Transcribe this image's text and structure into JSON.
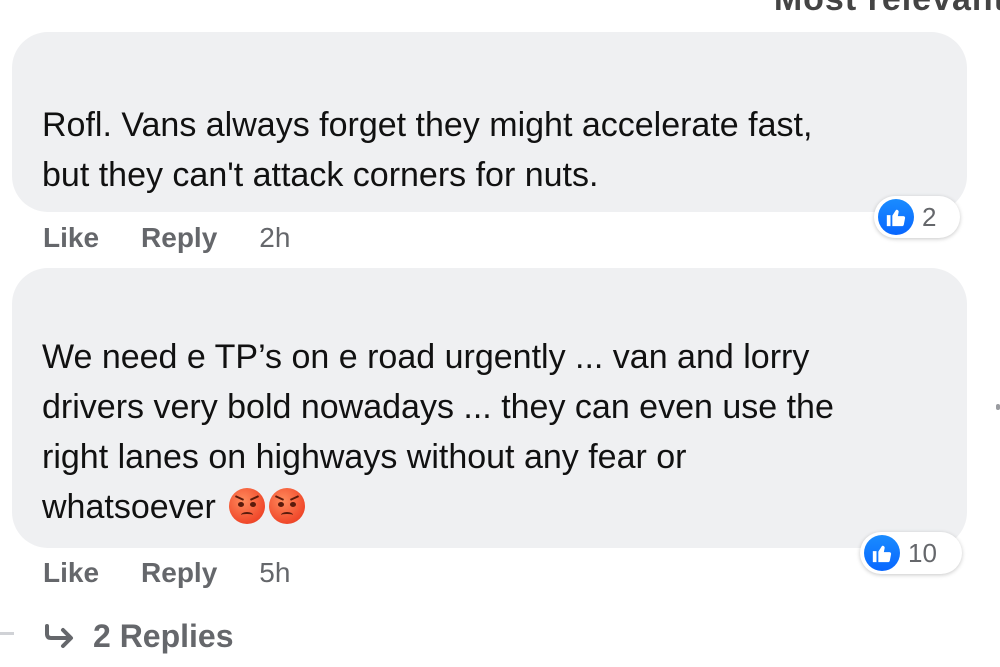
{
  "header_cutoff": "Most relevant",
  "comments": [
    {
      "author_ghost": "",
      "text": "Rofl. Vans always forget they might accelerate fast, but they can't attack corners for nuts.",
      "line1": "Rofl. Vans always forget they might accelerate fast,",
      "line2": "but they can't attack corners for nuts.",
      "reaction_icon": "thumbs-up-icon",
      "reaction_count": "2",
      "like_label": "Like",
      "reply_label": "Reply",
      "time": "2h"
    },
    {
      "author_ghost": "",
      "text": "We need e TP’s on e road urgently ... van and lorry drivers very bold nowadays ... they can even use the right lanes on highways without any fear or whatsoever",
      "line1": "We need e TP’s on e road urgently ... van and lorry",
      "line2": "drivers very bold nowadays ... they can even use the",
      "line3": "right lanes on highways without any fear or",
      "line4": "whatsoever",
      "emojis": [
        "pouting-face-icon",
        "pouting-face-icon"
      ],
      "reaction_icon": "thumbs-up-icon",
      "reaction_count": "10",
      "like_label": "Like",
      "reply_label": "Reply",
      "time": "5h"
    }
  ],
  "replies_link": {
    "icon": "reply-arrow-icon",
    "label": "2 Replies"
  },
  "colors": {
    "bubble_bg": "#eff0f2",
    "meta_text": "#65676b",
    "like_blue": "#0866ff",
    "body_text": "#050505"
  }
}
